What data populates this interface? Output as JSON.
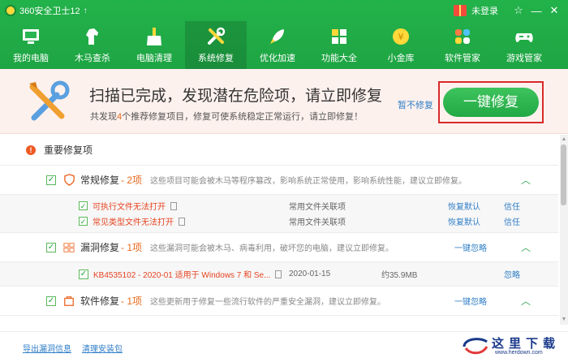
{
  "app": {
    "title": "360安全卫士12",
    "update_arrow": "↑",
    "login": "未登录",
    "controls": {
      "skin": "☆",
      "minimize": "—",
      "close": "✕"
    }
  },
  "nav": {
    "items": [
      {
        "label": "我的电脑",
        "icon": "monitor-icon"
      },
      {
        "label": "木马查杀",
        "icon": "horse-icon"
      },
      {
        "label": "电脑清理",
        "icon": "broom-icon"
      },
      {
        "label": "系统修复",
        "icon": "tools-icon",
        "active": true
      },
      {
        "label": "优化加速",
        "icon": "rocket-icon"
      },
      {
        "label": "功能大全",
        "icon": "grid-icon"
      },
      {
        "label": "小金库",
        "icon": "coin-icon"
      },
      {
        "label": "软件管家",
        "icon": "flower-icon"
      },
      {
        "label": "游戏管家",
        "icon": "gamepad-icon"
      }
    ]
  },
  "banner": {
    "title": "扫描已完成，发现潜在危险项，请立即修复",
    "sub_prefix": "共发现",
    "sub_count": "4",
    "sub_suffix": "个推荐修复项目，修复可使系统稳定正常运行，请立即修复！",
    "skip_label": "暂不修复",
    "fix_label": "一键修复"
  },
  "list": {
    "section_title": "重要修复项",
    "groups": [
      {
        "name": "常规修复",
        "count": "- 2项",
        "desc": "这些项目可能会被木马等程序篡改，影响系统正常使用，影响系统性能，建议立即修复。",
        "action": "",
        "chevron": "︿",
        "items": [
          {
            "name": "可执行文件无法打开",
            "type": "常用文件关联项",
            "act": "恢复默认",
            "act2": "信任"
          },
          {
            "name": "常见类型文件无法打开",
            "type": "常用文件关联项",
            "act": "恢复默认",
            "act2": "信任"
          }
        ]
      },
      {
        "name": "漏洞修复",
        "count": "- 1项",
        "desc": "这些漏洞可能会被木马、病毒利用，破坏您的电脑，建议立即修复。",
        "action": "一键忽略",
        "chevron": "︿",
        "kb": {
          "name": "KB4535102 - 2020-01 适用于 Windows 7 和 Se...",
          "date": "2020-01-15",
          "size": "约35.9MB",
          "act": "忽略"
        }
      },
      {
        "name": "软件修复",
        "count": "- 1项",
        "desc": "这些更新用于修复一些流行软件的严重安全漏洞，建议立即修复。",
        "action": "一键忽略",
        "chevron": "︿"
      }
    ]
  },
  "footer": {
    "export_link": "导出漏洞信息",
    "clean_link": "清理安装包",
    "watermark": "这里下载",
    "watermark_url": "www.herdown.com"
  },
  "colors": {
    "brand_green": "#22b24a",
    "accent_orange": "#e96a1d",
    "link_blue": "#2f7ec7",
    "highlight_red": "#d82a2a"
  }
}
